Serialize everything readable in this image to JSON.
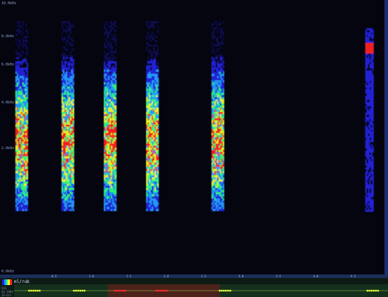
{
  "window": {
    "title": ""
  },
  "freq_labels": [
    "10.0kHz",
    "8.0kHz",
    "6.0kHz",
    "4.0kHz",
    "2.0kHz",
    "0.0kHz"
  ],
  "overview": {
    "file_label": "ml/rub",
    "info_lines": [
      "CH1",
      "44.1kHz",
      "16-bit"
    ],
    "time_ticks": [
      "0.5",
      "1.0",
      "1.5",
      "2.0",
      "2.5",
      "3.0",
      "3.5",
      "4.0",
      "4.5"
    ],
    "selection": {
      "start": 0.25,
      "end": 0.55
    }
  },
  "colors": {
    "background": "#05050f",
    "overview_bg": "#0e1a14",
    "selection": "#7a1a1a",
    "colormap": [
      "#0a0a50",
      "#2020e0",
      "#20a0ff",
      "#30ff80",
      "#f0ff20",
      "#ff2020"
    ]
  },
  "icons": [
    "colorbar-icon"
  ],
  "bursts": [
    {
      "start": 0.04,
      "end": 0.07
    },
    {
      "start": 0.16,
      "end": 0.19
    },
    {
      "start": 0.27,
      "end": 0.3
    },
    {
      "start": 0.38,
      "end": 0.41
    },
    {
      "start": 0.55,
      "end": 0.58
    },
    {
      "start": 0.95,
      "end": 0.97
    }
  ]
}
